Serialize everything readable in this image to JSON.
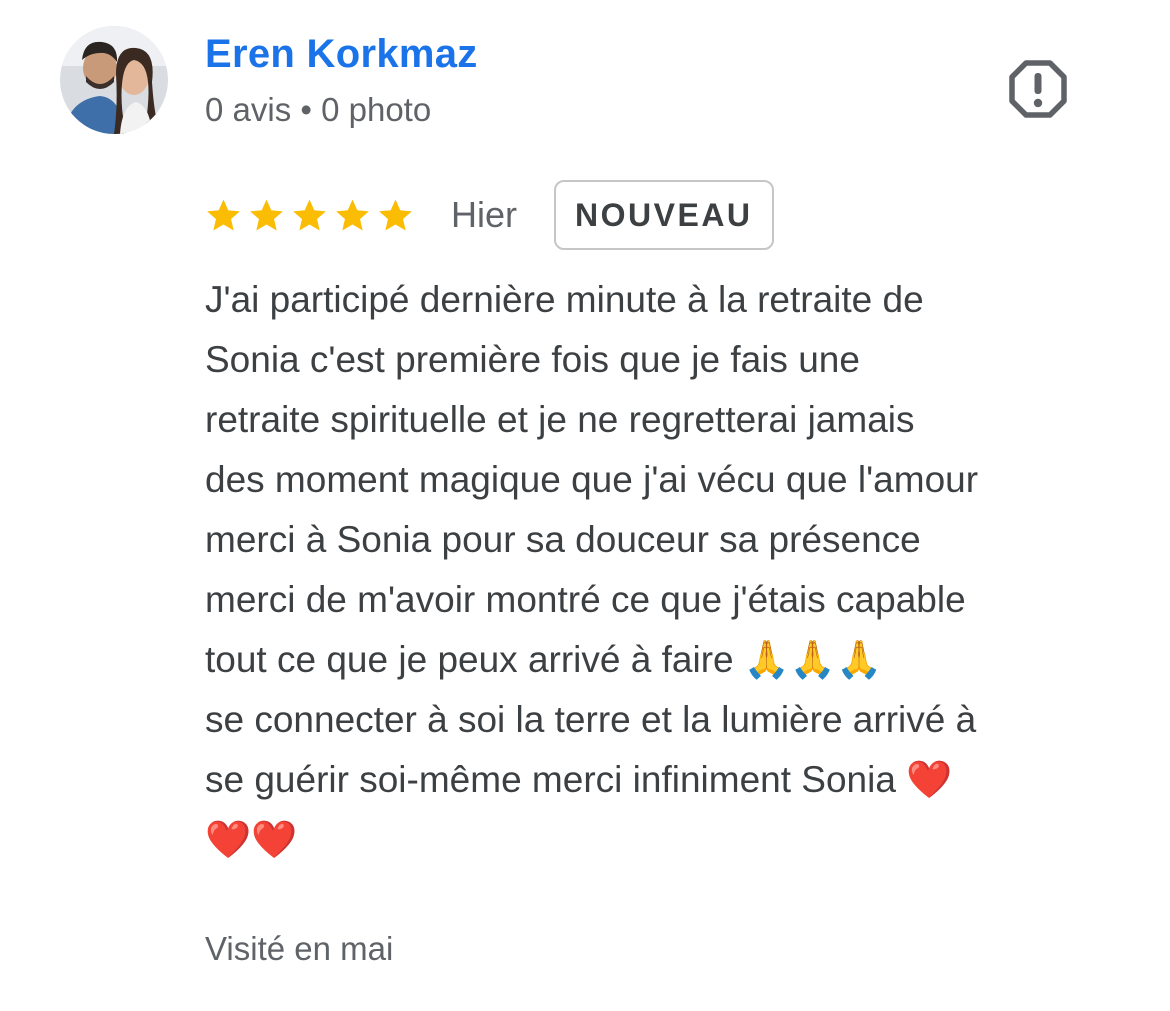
{
  "reviewer": {
    "name": "Eren Korkmaz",
    "meta": "0 avis • 0 photo",
    "avatar_icon": "profile-photo"
  },
  "report": {
    "icon": "report-flag-icon"
  },
  "rating": {
    "stars": 5,
    "max_stars": 5,
    "star_color": "#fbbc04",
    "date": "Hier",
    "badge": "NOUVEAU"
  },
  "review": {
    "lines": [
      "J'ai participé dernière minute à la retraite de",
      "Sonia c'est première fois que je fais une",
      "retraite spirituelle et je ne regretterai jamais",
      "des moment magique que j'ai vécu que l'amour",
      "merci à Sonia pour sa douceur sa présence",
      "merci de m'avoir montré ce que j'étais capable",
      "tout ce que je peux arrivé à faire 🙏🙏🙏",
      "se connecter à soi la terre et la lumière arrivé à",
      "se guérir soi-même merci infiniment Sonia ❤️",
      "❤️❤️"
    ]
  },
  "visit": {
    "text": "Visité en mai"
  },
  "colors": {
    "name_blue": "#1a73e8",
    "text_dark": "#3c4043",
    "text_grey": "#5f6368",
    "star_gold": "#fbbc04"
  }
}
